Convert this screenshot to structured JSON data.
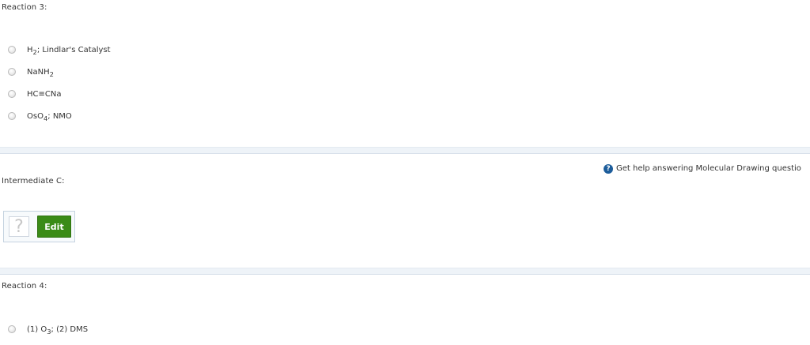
{
  "reaction3": {
    "title": "Reaction 3:",
    "options": [
      {
        "html": "H<sub>2</sub>; Lindlar's Catalyst",
        "text": "H2; Lindlar's Catalyst"
      },
      {
        "html": "NaNH<sub>2</sub>",
        "text": "NaNH2"
      },
      {
        "html": "HC≡CNa",
        "text": "HC≡CNa"
      },
      {
        "html": "OsO<sub>4</sub>; NMO",
        "text": "OsO4; NMO"
      }
    ]
  },
  "help": {
    "icon": "question-circle-icon",
    "text": "Get help answering Molecular Drawing questio"
  },
  "intermediate": {
    "title": "Intermediate C:",
    "placeholder_icon": "?",
    "edit_label": "Edit"
  },
  "reaction4": {
    "title": "Reaction 4:",
    "options": [
      {
        "html": "(1) O<sub>3</sub>; (2) DMS",
        "text": "(1) O3; (2) DMS"
      }
    ]
  },
  "colors": {
    "edit_button": "#3a8b17",
    "help_icon": "#1d5d9b",
    "separator": "#eef3f8"
  }
}
